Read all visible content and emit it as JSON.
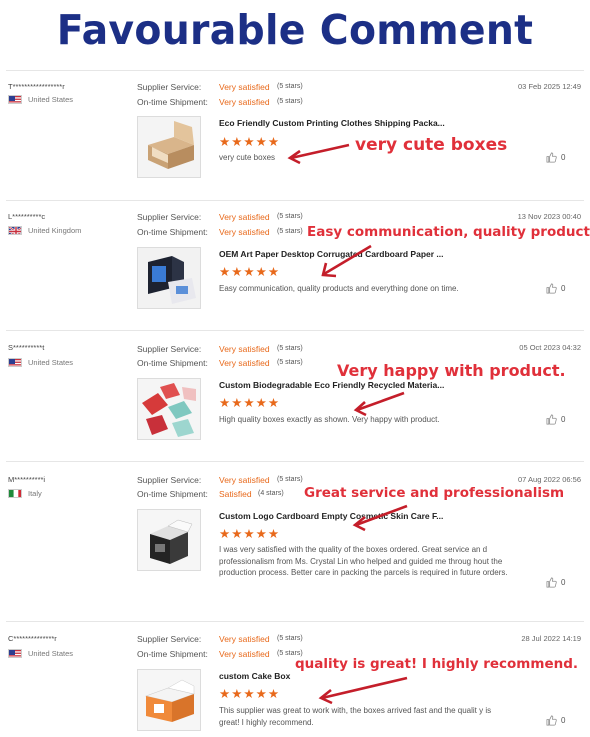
{
  "page": {
    "title": "Favourable Comment"
  },
  "labels": {
    "supplier_service": "Supplier Service:",
    "ontime_shipment": "On-time Shipment:",
    "rating_stars": "★★★★★"
  },
  "colors": {
    "title": "#1c2f86",
    "accent": "#e8691b",
    "annotation": "#e0303a"
  },
  "reviews": [
    {
      "user": "T*****************r",
      "country": "United States",
      "flag": "us-flag-icon",
      "supplier_value": "Very satisfied",
      "supplier_stars": "(5 stars)",
      "shipment_value": "Very satisfied",
      "shipment_stars": "(5 stars)",
      "date": "03 Feb 2025 12:49",
      "product": "Eco Friendly Custom Printing Clothes Shipping Packa...",
      "rating": 5,
      "comment": "very cute boxes",
      "likes": "0",
      "annotation": "very cute boxes"
    },
    {
      "user": "L**********c",
      "country": "United Kingdom",
      "flag": "uk-flag-icon",
      "supplier_value": "Very satisfied",
      "supplier_stars": "(5 stars)",
      "shipment_value": "Very satisfied",
      "shipment_stars": "(5 stars)",
      "date": "13 Nov 2023 00:40",
      "product": "OEM Art Paper Desktop Corrugated Cardboard Paper ...",
      "rating": 5,
      "comment": "Easy communication, quality products and everything done on time.",
      "likes": "0",
      "annotation": "Easy communication, quality products"
    },
    {
      "user": "S**********t",
      "country": "United States",
      "flag": "us-flag-icon",
      "supplier_value": "Very satisfied",
      "supplier_stars": "(5 stars)",
      "shipment_value": "Very satisfied",
      "shipment_stars": "(5 stars)",
      "date": "05 Oct 2023 04:32",
      "product": "Custom Biodegradable Eco Friendly Recycled Materia...",
      "rating": 5,
      "comment": "High quality boxes exactly as shown. Very happy with product.",
      "likes": "0",
      "annotation": "Very happy with product."
    },
    {
      "user": "M**********i",
      "country": "Italy",
      "flag": "italy-flag-icon",
      "supplier_value": "Very satisfied",
      "supplier_stars": "(5 stars)",
      "shipment_value": "Satisfied",
      "shipment_stars": "(4 stars)",
      "date": "07 Aug 2022 06:56",
      "product": "Custom Logo Cardboard Empty Cosmetic Skin Care F...",
      "rating": 5,
      "comment": "I was very satisfied with the quality of the boxes ordered. Great service an d professionalism from Ms. Crystal Lin who helped and guided me throug hout the production process. Better care in packing the parcels is required in future orders.",
      "likes": "0",
      "annotation": "Great service and professionalism"
    },
    {
      "user": "C**************r",
      "country": "United States",
      "flag": "us-flag-icon",
      "supplier_value": "Very satisfied",
      "supplier_stars": "(5 stars)",
      "shipment_value": "Very satisfied",
      "shipment_stars": "(5 stars)",
      "date": "28 Jul 2022 14:19",
      "product": "custom Cake Box",
      "rating": 5,
      "comment": "This supplier was great to work with, the boxes arrived fast and the qualit y is great! I highly recommend.",
      "likes": "0",
      "annotation": "quality is great!  I highly recommend."
    }
  ]
}
